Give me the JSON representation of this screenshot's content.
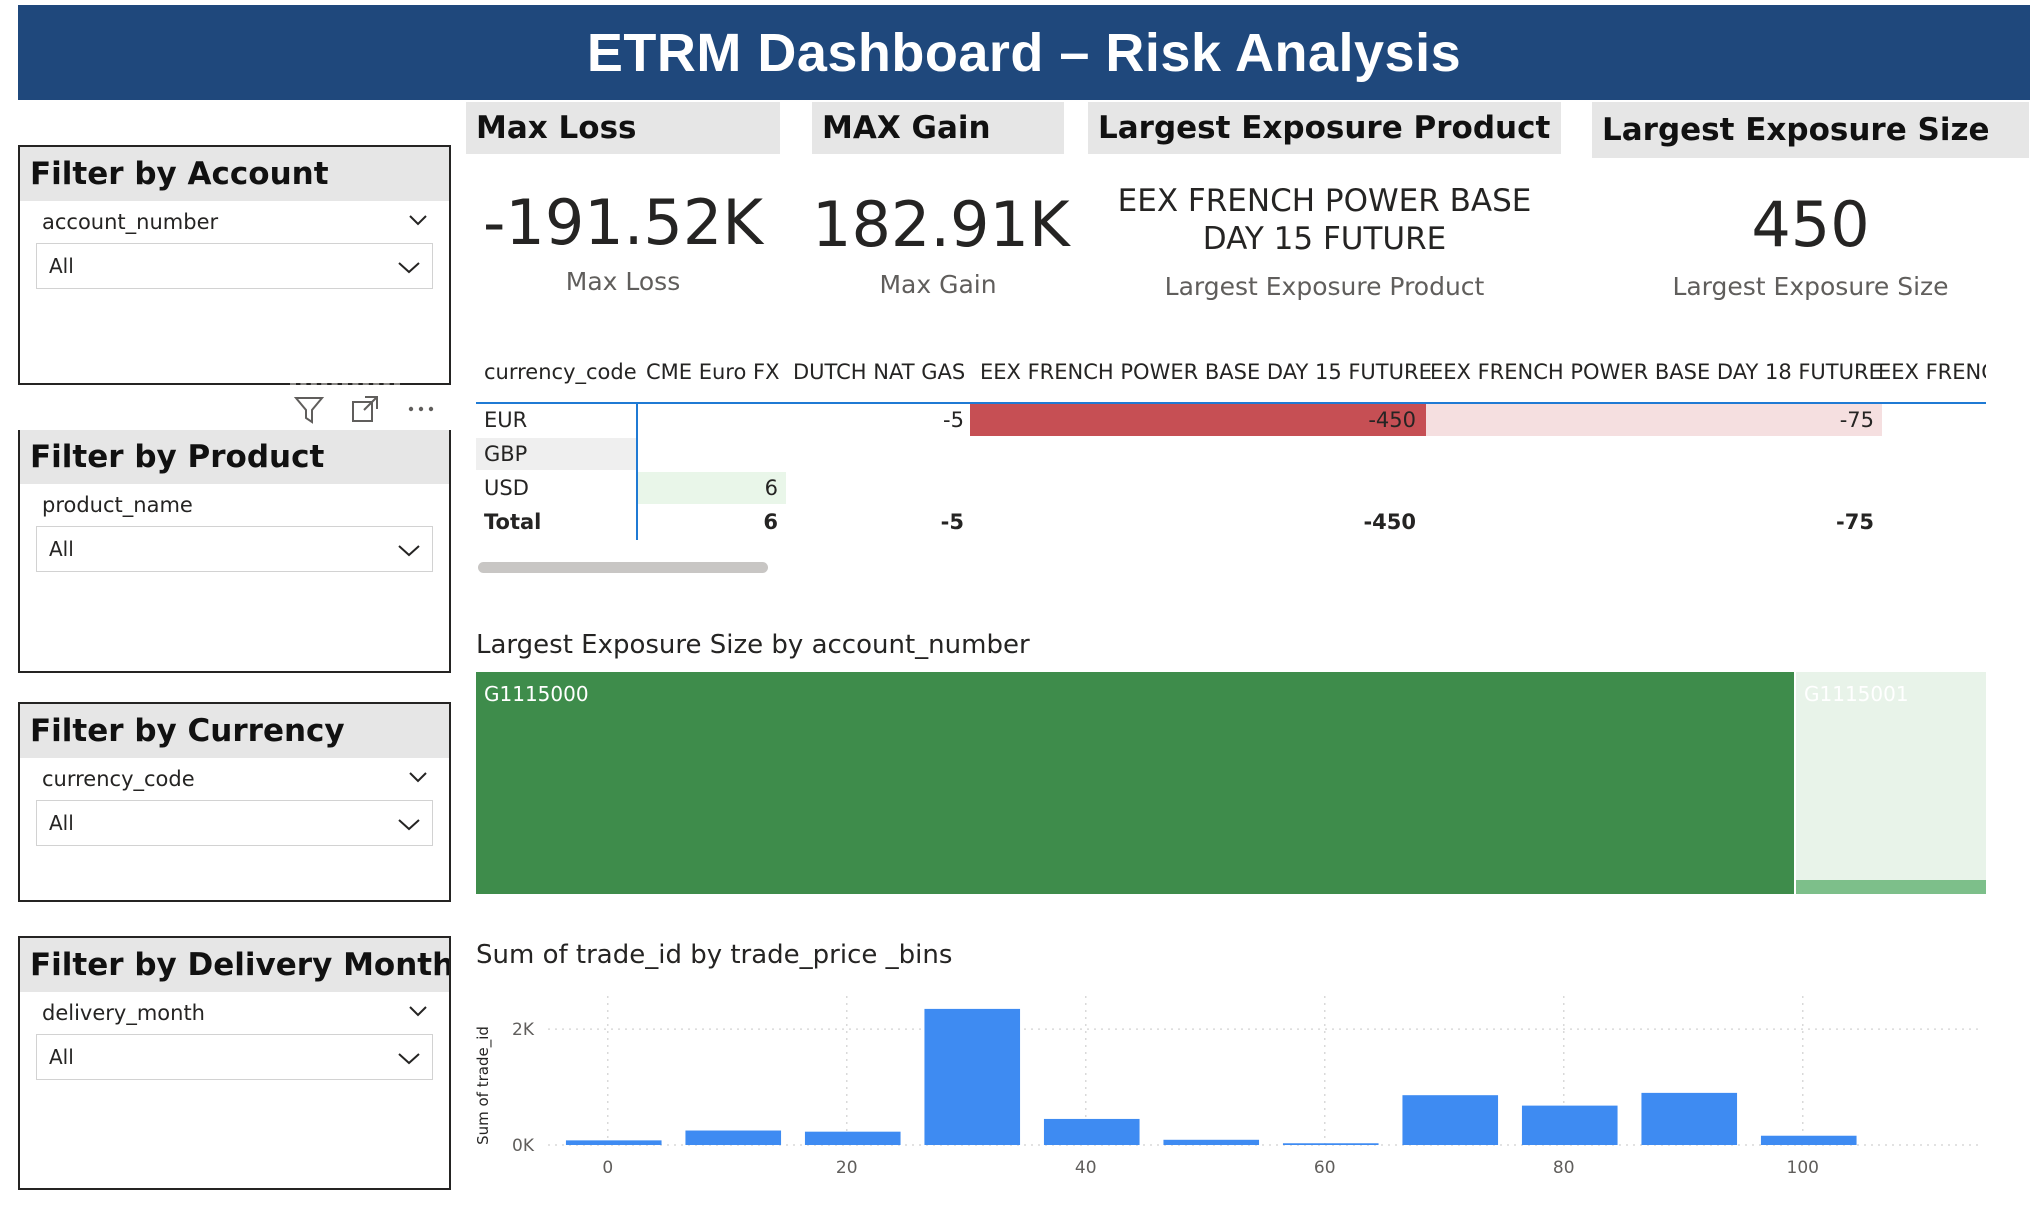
{
  "banner": {
    "title": "ETRM Dashboard – Risk Analysis"
  },
  "filters": [
    {
      "title": "Filter by Account",
      "field": "account_number",
      "value": "All"
    },
    {
      "title": "Filter by Product",
      "field": "product_name",
      "value": "All"
    },
    {
      "title": "Filter by Currency",
      "field": "currency_code",
      "value": "All"
    },
    {
      "title": "Filter by Delivery Month",
      "field": "delivery_month",
      "value": "All"
    }
  ],
  "kpis": [
    {
      "header": "Max Loss",
      "value": "-191.52K",
      "label": "Max Loss"
    },
    {
      "header": "MAX Gain",
      "value": "182.91K",
      "label": "Max Gain"
    },
    {
      "header": "Largest Exposure Product",
      "value_line1": "EEX FRENCH POWER BASE",
      "value_line2": "DAY 15 FUTURE",
      "label": "Largest Exposure Product"
    },
    {
      "header": "Largest Exposure Size",
      "value": "450",
      "label": "Largest Exposure Size"
    }
  ],
  "matrix": {
    "row_header": "currency_code",
    "columns": [
      "CME Euro FX",
      "DUTCH NAT GAS",
      "EEX FRENCH POWER BASE DAY 15 FUTURE",
      "EEX FRENCH POWER BASE DAY 18 FUTURE",
      "EEX FRENC"
    ],
    "rows": [
      {
        "label": "EUR",
        "cells": [
          "",
          "-5",
          "-450",
          "-75",
          ""
        ]
      },
      {
        "label": "GBP",
        "cells": [
          "",
          "",
          "",
          "",
          ""
        ]
      },
      {
        "label": "USD",
        "cells": [
          "6",
          "",
          "",
          "",
          ""
        ]
      }
    ],
    "total": {
      "label": "Total",
      "cells": [
        "6",
        "-5",
        "-450",
        "-75",
        ""
      ]
    },
    "colors": {
      "strong_negative": "#c64f54",
      "light_negative": "#f5dfe0",
      "light_positive": "#e9f6e9",
      "grid_line": "#1f7ad4"
    }
  },
  "treemap": {
    "title": "Largest Exposure Size by account_number",
    "items": [
      {
        "label": "G1115000",
        "color": "#3e8c4b"
      },
      {
        "label": "G1115001",
        "color": "#e8f3e9"
      }
    ]
  },
  "chart_data": {
    "type": "bar",
    "title": "Sum of trade_id by trade_price _bins",
    "xlabel": "",
    "ylabel": "Sum of trade_id",
    "x": [
      0,
      10,
      20,
      30,
      40,
      50,
      60,
      70,
      80,
      90,
      100
    ],
    "values": [
      80,
      250,
      230,
      2350,
      450,
      90,
      30,
      860,
      680,
      900,
      160
    ],
    "xticks": [
      0,
      20,
      40,
      60,
      80,
      100
    ],
    "yticks": [
      {
        "value": 0,
        "label": "0K"
      },
      {
        "value": 2000,
        "label": "2K"
      }
    ],
    "xlim": [
      -5,
      115
    ],
    "ylim": [
      0,
      2400
    ],
    "grid": true,
    "color": "#3e8bf2"
  },
  "icons": [
    "filter-icon",
    "focus-mode-icon",
    "more-options-icon",
    "chevron-down-icon"
  ]
}
